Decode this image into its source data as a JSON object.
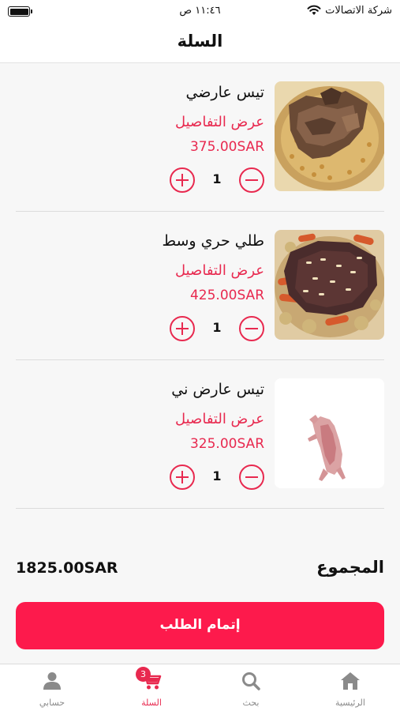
{
  "status_bar": {
    "carrier": "شركة الاتصالات",
    "time": "١١:٤٦ ص"
  },
  "header": {
    "title": "السلة"
  },
  "cart": {
    "items": [
      {
        "name": "تيس عارضي",
        "details_link": "عرض التفاصيل",
        "price": "375.00SAR",
        "quantity": "1"
      },
      {
        "name": "طلي حري وسط",
        "details_link": "عرض التفاصيل",
        "price": "425.00SAR",
        "quantity": "1"
      },
      {
        "name": "تيس عارض ني",
        "details_link": "عرض التفاصيل",
        "price": "325.00SAR",
        "quantity": "1"
      }
    ]
  },
  "summary": {
    "total_label": "المجموع",
    "total_value": "1825.00SAR"
  },
  "checkout": {
    "label": "إتمام الطلب"
  },
  "tab_bar": {
    "tabs": [
      {
        "label": "الرئيسية",
        "icon": "home-icon"
      },
      {
        "label": "بحث",
        "icon": "search-icon"
      },
      {
        "label": "السلة",
        "icon": "cart-icon",
        "badge": "3",
        "active": true
      },
      {
        "label": "حسابي",
        "icon": "person-icon"
      }
    ]
  },
  "colors": {
    "accent": "#e8294f",
    "checkout_button": "#fd1a4c",
    "inactive_tab": "#8a8a8a"
  }
}
